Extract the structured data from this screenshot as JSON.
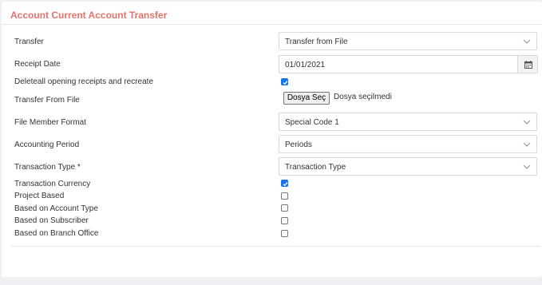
{
  "page": {
    "title": "Account Current Account Transfer"
  },
  "form": {
    "transfer": {
      "label": "Transfer",
      "value": "Transfer from File"
    },
    "receipt_date": {
      "label": "Receipt Date",
      "value": "01/01/2021"
    },
    "delete_opening": {
      "label": "Deleteall opening receipts and recreate",
      "checked": true
    },
    "transfer_from_file": {
      "label": "Transfer From File",
      "button": "Dosya Seç",
      "status": "Dosya seçilmedi"
    },
    "file_member_format": {
      "label": "File Member Format",
      "value": "Special Code 1"
    },
    "accounting_period": {
      "label": "Accounting Period",
      "value": "Periods"
    },
    "transaction_type": {
      "label": "Transaction Type *",
      "value": "Transaction Type"
    },
    "transaction_currency": {
      "label": "Transaction Currency",
      "checked": true
    },
    "project_based": {
      "label": "Project Based",
      "checked": false
    },
    "based_on_account_type": {
      "label": "Based on Account Type",
      "checked": false
    },
    "based_on_subscriber": {
      "label": "Based on Subscriber",
      "checked": false
    },
    "based_on_branch_office": {
      "label": "Based on Branch Office",
      "checked": false
    }
  },
  "icons": {
    "chevron": "chevron-down-icon",
    "calendar": "calendar-icon",
    "check": "check-icon"
  },
  "colors": {
    "title": "#e2736b",
    "checkbox_checked": "#1a73e8"
  }
}
